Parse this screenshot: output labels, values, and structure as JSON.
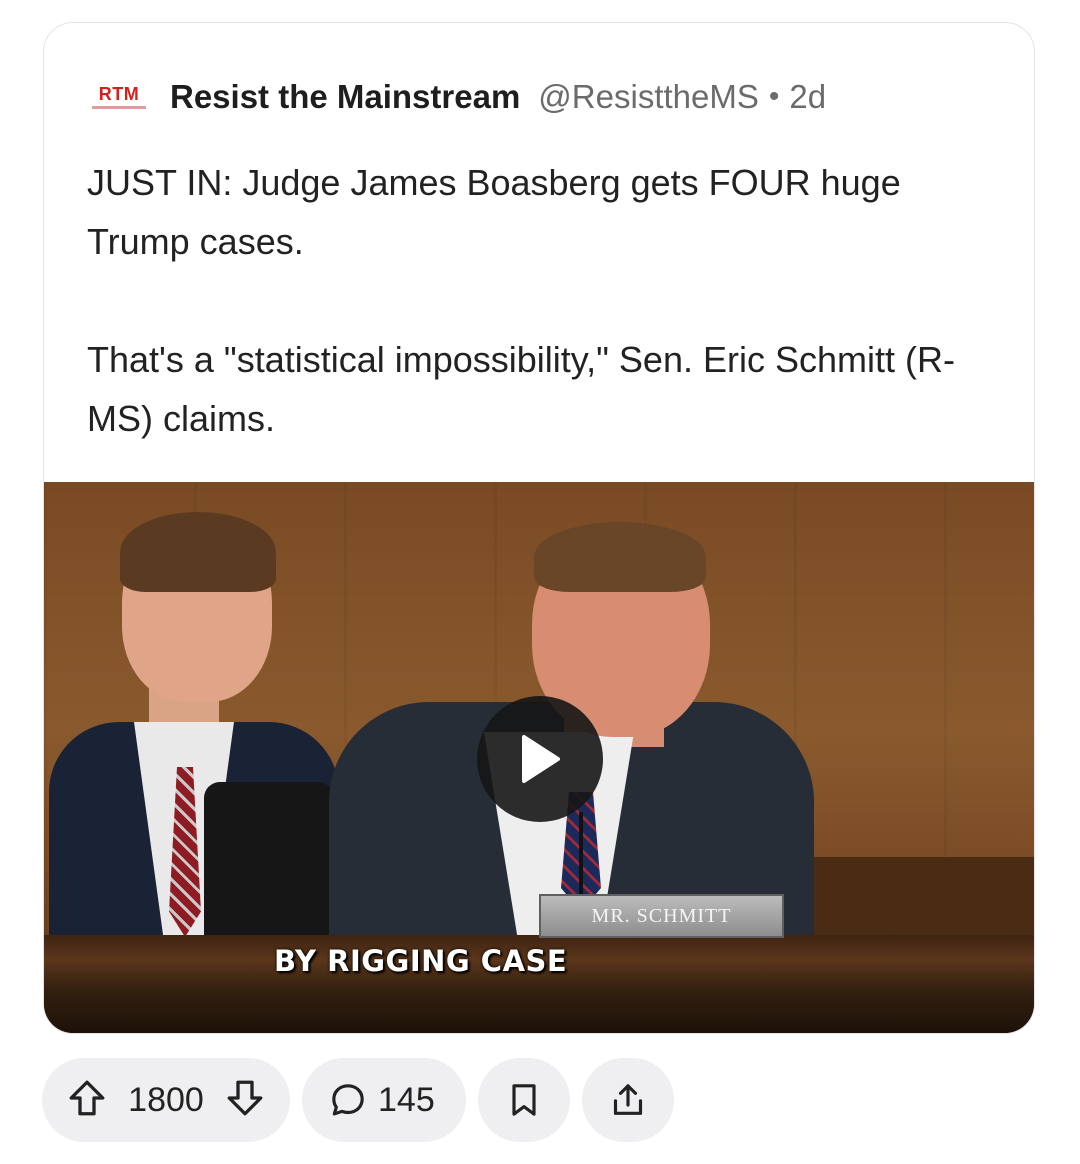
{
  "post": {
    "logo_text": "RTM",
    "author": "Resist the Mainstream",
    "handle": "@ResisttheMS",
    "separator": "•",
    "time": "2d",
    "body": [
      "JUST IN: Judge James Boasberg gets FOUR huge Trump cases.",
      "That's a \"statistical impossibility,\" Sen. Eric Schmitt (R-MS) claims."
    ]
  },
  "video": {
    "nameplate": "MR. SCHMITT",
    "caption": "BY RIGGING CASE",
    "play_icon": "play-icon"
  },
  "actions": {
    "upvotes": "1800",
    "comments": "145",
    "icons": [
      "upvote-icon",
      "downvote-icon",
      "comment-icon",
      "bookmark-icon",
      "share-icon"
    ]
  }
}
